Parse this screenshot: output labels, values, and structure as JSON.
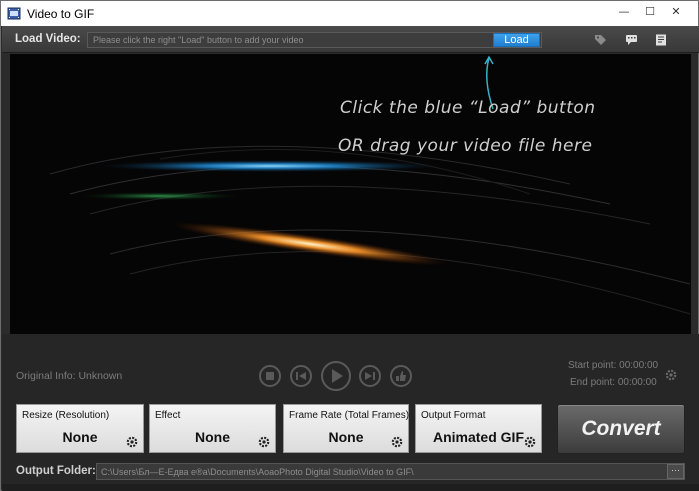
{
  "window": {
    "title": "Video to GIF",
    "minimize": "▭",
    "restore": "◻",
    "close": "✕"
  },
  "load_bar": {
    "label": "Load Video:",
    "placeholder": "Please click the right \"Load\" button to add your video",
    "load_button": "Load",
    "icons": [
      "tag-icon",
      "chat-icon",
      "list-icon"
    ]
  },
  "preview": {
    "hint_line1": "Click the blue “Load” button",
    "hint_line2": "OR drag your video file here"
  },
  "controls": {
    "original_info": "Original Info: Unknown",
    "start_point": "Start point: 00:00:00",
    "end_point": "End point: 00:00:00"
  },
  "options": {
    "resize": {
      "title": "Resize (Resolution)",
      "value": "None"
    },
    "effect": {
      "title": "Effect",
      "value": "None"
    },
    "frame_rate": {
      "title": "Frame Rate",
      "title_suffix": "(Total Frames)",
      "value": "None"
    },
    "output_format": {
      "title": "Output Format",
      "value": "Animated GIF"
    },
    "convert_label": "Convert"
  },
  "output": {
    "label": "Output Folder:",
    "path": "C:\\Users\\Бл—Е-Едва е®а\\Documents\\AoaoPhoto Digital Studio\\Video to GIF\\",
    "browse": "···"
  },
  "colors": {
    "accent_blue": "#2b8fe0",
    "panel_dark": "#262626",
    "preview_bg": "#050505"
  }
}
